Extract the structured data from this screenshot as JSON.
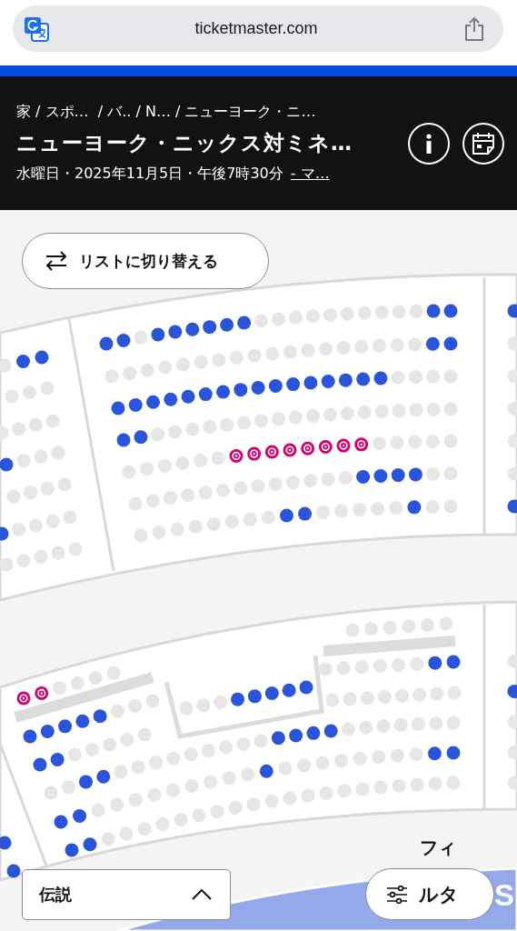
{
  "browser": {
    "url": "ticketmaster.com"
  },
  "event": {
    "breadcrumb": "家 / スポ…  / バ.. / N… / ニューヨーク・ニ…",
    "title": "ニューヨーク・ニックス対ミネ…",
    "date": "水曜日・2025年11月5日・午後7時30分",
    "venue_link": "- マ…"
  },
  "list_toggle": {
    "label": "リストに切り替える"
  },
  "seat_map": {
    "rows": [
      {
        "seats": [
          {
            "kind": "open"
          },
          {
            "kind": "open"
          },
          {
            "kind": "sold"
          },
          {
            "kind": "open"
          },
          {
            "kind": "open"
          },
          {
            "kind": "open"
          },
          {
            "kind": "open"
          },
          {
            "kind": "open"
          },
          {
            "kind": "open"
          },
          {
            "kind": "sold"
          },
          {
            "kind": "sold"
          },
          {
            "kind": "sold"
          },
          {
            "kind": "sold"
          },
          {
            "kind": "sold"
          },
          {
            "kind": "sold"
          },
          {
            "kind": "sold"
          },
          {
            "kind": "sold"
          },
          {
            "kind": "sold"
          },
          {
            "kind": "sold"
          },
          {
            "kind": "open"
          },
          {
            "kind": "open"
          }
        ]
      },
      {
        "seats": [
          {
            "kind": "sold"
          },
          {
            "kind": "sold"
          },
          {
            "kind": "sold"
          },
          {
            "kind": "sold"
          },
          {
            "kind": "sold"
          },
          {
            "kind": "sold"
          },
          {
            "kind": "sold"
          },
          {
            "kind": "sold"
          },
          {
            "kind": "sold"
          },
          {
            "kind": "sold"
          },
          {
            "kind": "sold"
          },
          {
            "kind": "sold"
          },
          {
            "kind": "sold"
          },
          {
            "kind": "sold"
          },
          {
            "kind": "sold"
          },
          {
            "kind": "sold"
          },
          {
            "kind": "sold"
          },
          {
            "kind": "sold"
          },
          {
            "kind": "open"
          },
          {
            "kind": "open"
          }
        ]
      },
      {
        "seats": [
          {
            "kind": "open"
          },
          {
            "kind": "open"
          },
          {
            "kind": "open"
          },
          {
            "kind": "open"
          },
          {
            "kind": "open"
          },
          {
            "kind": "open"
          },
          {
            "kind": "open"
          },
          {
            "kind": "open"
          },
          {
            "kind": "open"
          },
          {
            "kind": "open"
          },
          {
            "kind": "open"
          },
          {
            "kind": "open"
          },
          {
            "kind": "open"
          },
          {
            "kind": "open"
          },
          {
            "kind": "open"
          },
          {
            "kind": "open"
          },
          {
            "kind": "sold"
          },
          {
            "kind": "sold"
          },
          {
            "kind": "sold"
          },
          {
            "kind": "sold"
          }
        ]
      },
      {
        "seats": [
          {
            "kind": "open"
          },
          {
            "kind": "open"
          },
          {
            "kind": "sold"
          },
          {
            "kind": "sold"
          },
          {
            "kind": "sold"
          },
          {
            "kind": "sold"
          },
          {
            "kind": "sold"
          },
          {
            "kind": "sold"
          },
          {
            "kind": "sold"
          },
          {
            "kind": "sold"
          },
          {
            "kind": "sold"
          },
          {
            "kind": "sold"
          },
          {
            "kind": "sold"
          },
          {
            "kind": "sold"
          },
          {
            "kind": "sold"
          },
          {
            "kind": "sold"
          },
          {
            "kind": "sold"
          },
          {
            "kind": "sold"
          },
          {
            "kind": "sold"
          },
          {
            "kind": "sold"
          }
        ]
      },
      {
        "seats": [
          {
            "kind": "sold"
          },
          {
            "kind": "sold"
          },
          {
            "kind": "sold"
          },
          {
            "kind": "sold"
          },
          {
            "kind": "sold"
          },
          {
            "kind": "sold"
          },
          {
            "kind": "resale"
          },
          {
            "kind": "resale"
          },
          {
            "kind": "resale"
          },
          {
            "kind": "resale"
          },
          {
            "kind": "resale"
          },
          {
            "kind": "resale"
          },
          {
            "kind": "resale"
          },
          {
            "kind": "resale"
          },
          {
            "kind": "sold"
          },
          {
            "kind": "sold"
          },
          {
            "kind": "sold"
          },
          {
            "kind": "sold"
          },
          {
            "kind": "sold"
          }
        ]
      },
      {
        "seats": [
          {
            "kind": "sold"
          },
          {
            "kind": "sold"
          },
          {
            "kind": "sold"
          },
          {
            "kind": "sold"
          },
          {
            "kind": "sold"
          },
          {
            "kind": "sold"
          },
          {
            "kind": "sold"
          },
          {
            "kind": "sold"
          },
          {
            "kind": "sold"
          },
          {
            "kind": "sold"
          },
          {
            "kind": "sold"
          },
          {
            "kind": "sold"
          },
          {
            "kind": "sold"
          },
          {
            "kind": "open"
          },
          {
            "kind": "open"
          },
          {
            "kind": "open"
          },
          {
            "kind": "open"
          },
          {
            "kind": "sold"
          },
          {
            "kind": "sold"
          }
        ]
      },
      {
        "seats": [
          {
            "kind": "sold"
          },
          {
            "kind": "sold"
          },
          {
            "kind": "sold"
          },
          {
            "kind": "sold"
          },
          {
            "kind": "sold"
          },
          {
            "kind": "sold"
          },
          {
            "kind": "sold"
          },
          {
            "kind": "sold"
          },
          {
            "kind": "open"
          },
          {
            "kind": "open"
          },
          {
            "kind": "sold"
          },
          {
            "kind": "sold"
          },
          {
            "kind": "sold"
          },
          {
            "kind": "sold"
          },
          {
            "kind": "sold"
          },
          {
            "kind": "open"
          },
          {
            "kind": "sold"
          },
          {
            "kind": "sold"
          }
        ]
      },
      {
        "seats": [
          {
            "kind": "sold"
          },
          {
            "kind": "open"
          },
          {
            "kind": "open"
          }
        ]
      },
      {
        "seats": [
          {
            "kind": "sold"
          },
          {
            "kind": "sold"
          },
          {
            "kind": "sold"
          }
        ]
      },
      {
        "seats": [
          {
            "kind": "sold"
          },
          {
            "kind": "sold"
          },
          {
            "kind": "sold"
          },
          {
            "kind": "sold"
          }
        ]
      },
      {
        "seats": [
          {
            "kind": "open"
          },
          {
            "kind": "sold"
          },
          {
            "kind": "sold"
          },
          {
            "kind": "sold"
          }
        ]
      },
      {
        "seats": [
          {
            "kind": "sold"
          },
          {
            "kind": "sold"
          },
          {
            "kind": "sold"
          },
          {
            "kind": "sold"
          }
        ]
      },
      {
        "seats": [
          {
            "kind": "open"
          },
          {
            "kind": "sold"
          },
          {
            "kind": "sold"
          },
          {
            "kind": "sold"
          },
          {
            "kind": "sold"
          }
        ]
      },
      {
        "seats": [
          {
            "kind": "sold"
          },
          {
            "kind": "sold"
          },
          {
            "kind": "sold"
          },
          {
            "kind": "sold"
          },
          {
            "kind": "sold"
          }
        ]
      },
      {
        "seats": [
          {
            "kind": "open"
          },
          {
            "kind": "sold"
          },
          {
            "kind": "sold"
          },
          {
            "kind": "sold"
          },
          {
            "kind": "sold"
          },
          {
            "kind": "sold"
          },
          {
            "kind": "open"
          }
        ]
      },
      {
        "seats": [
          {
            "kind": "sold"
          },
          {
            "kind": "sold"
          },
          {
            "kind": "sold"
          },
          {
            "kind": "sold"
          },
          {
            "kind": "sold"
          },
          {
            "kind": "sold"
          }
        ]
      },
      {
        "seats": [
          {
            "kind": "sold"
          },
          {
            "kind": "sold"
          },
          {
            "kind": "sold"
          },
          {
            "kind": "sold"
          },
          {
            "kind": "sold"
          },
          {
            "kind": "sold"
          },
          {
            "kind": "open"
          },
          {
            "kind": "open"
          }
        ]
      },
      {
        "seats": [
          {
            "kind": "sold"
          },
          {
            "kind": "sold"
          },
          {
            "kind": "sold"
          },
          {
            "kind": "sold"
          },
          {
            "kind": "sold"
          },
          {
            "kind": "sold"
          },
          {
            "kind": "sold"
          },
          {
            "kind": "sold"
          }
        ]
      },
      {
        "seats": [
          {
            "kind": "resale"
          },
          {
            "kind": "resale"
          },
          {
            "kind": "sold"
          },
          {
            "kind": "sold"
          },
          {
            "kind": "sold"
          },
          {
            "kind": "sold"
          }
        ]
      },
      {
        "seats": [
          {
            "kind": "open"
          },
          {
            "kind": "open"
          },
          {
            "kind": "open"
          },
          {
            "kind": "open"
          },
          {
            "kind": "open"
          },
          {
            "kind": "sold"
          },
          {
            "kind": "sold"
          },
          {
            "kind": "sold"
          }
        ]
      },
      {
        "seats": [
          {
            "kind": "sold"
          },
          {
            "kind": "sold"
          },
          {
            "kind": "sold"
          },
          {
            "kind": "open"
          },
          {
            "kind": "open"
          },
          {
            "kind": "open"
          },
          {
            "kind": "open"
          },
          {
            "kind": "open"
          }
        ]
      },
      {
        "seats": [
          {
            "kind": "open"
          },
          {
            "kind": "open"
          },
          {
            "kind": "sold"
          },
          {
            "kind": "sold"
          },
          {
            "kind": "sold"
          },
          {
            "kind": "sold"
          },
          {
            "kind": "sold"
          }
        ]
      },
      {
        "seats": [
          {
            "kind": "sold"
          },
          {
            "kind": "sold"
          },
          {
            "kind": "open"
          },
          {
            "kind": "open"
          },
          {
            "kind": "sold"
          },
          {
            "kind": "sold"
          },
          {
            "kind": "sold"
          },
          {
            "kind": "sold"
          },
          {
            "kind": "sold"
          },
          {
            "kind": "sold"
          },
          {
            "kind": "sold"
          },
          {
            "kind": "sold"
          },
          {
            "kind": "sold"
          },
          {
            "kind": "open"
          },
          {
            "kind": "open"
          },
          {
            "kind": "open"
          },
          {
            "kind": "open"
          },
          {
            "kind": "sold"
          },
          {
            "kind": "sold"
          },
          {
            "kind": "sold"
          },
          {
            "kind": "sold"
          },
          {
            "kind": "sold"
          },
          {
            "kind": "sold"
          },
          {
            "kind": "sold"
          }
        ]
      },
      {
        "seats": [
          {
            "kind": "open"
          },
          {
            "kind": "open"
          },
          {
            "kind": "sold"
          },
          {
            "kind": "sold"
          },
          {
            "kind": "sold"
          },
          {
            "kind": "sold"
          },
          {
            "kind": "sold"
          },
          {
            "kind": "sold"
          },
          {
            "kind": "sold"
          },
          {
            "kind": "sold"
          },
          {
            "kind": "sold"
          },
          {
            "kind": "open"
          },
          {
            "kind": "sold"
          },
          {
            "kind": "sold"
          },
          {
            "kind": "sold"
          },
          {
            "kind": "sold"
          },
          {
            "kind": "sold"
          },
          {
            "kind": "sold"
          },
          {
            "kind": "sold"
          },
          {
            "kind": "sold"
          },
          {
            "kind": "open"
          },
          {
            "kind": "open"
          }
        ]
      },
      {
        "seats": [
          {
            "kind": "open"
          },
          {
            "kind": "open"
          },
          {
            "kind": "sold"
          },
          {
            "kind": "sold"
          },
          {
            "kind": "sold"
          },
          {
            "kind": "sold"
          },
          {
            "kind": "sold"
          },
          {
            "kind": "sold"
          },
          {
            "kind": "sold"
          },
          {
            "kind": "sold"
          },
          {
            "kind": "sold"
          },
          {
            "kind": "sold"
          },
          {
            "kind": "sold"
          },
          {
            "kind": "sold"
          },
          {
            "kind": "sold"
          },
          {
            "kind": "sold"
          },
          {
            "kind": "sold"
          },
          {
            "kind": "sold"
          },
          {
            "kind": "sold"
          },
          {
            "kind": "sold"
          },
          {
            "kind": "sold"
          },
          {
            "kind": "sold"
          }
        ]
      },
      {
        "seats": [
          {
            "kind": "sold"
          },
          {
            "kind": "open"
          },
          {
            "kind": "sold"
          },
          {
            "kind": "sold"
          },
          {
            "kind": "sold"
          }
        ]
      },
      {
        "seats": [
          {
            "kind": "open"
          },
          {
            "kind": "open"
          }
        ]
      }
    ]
  },
  "court_label": "S",
  "legend": {
    "label": "伝説"
  },
  "filter": {
    "label_above": "フィ",
    "label": "ルタ"
  }
}
